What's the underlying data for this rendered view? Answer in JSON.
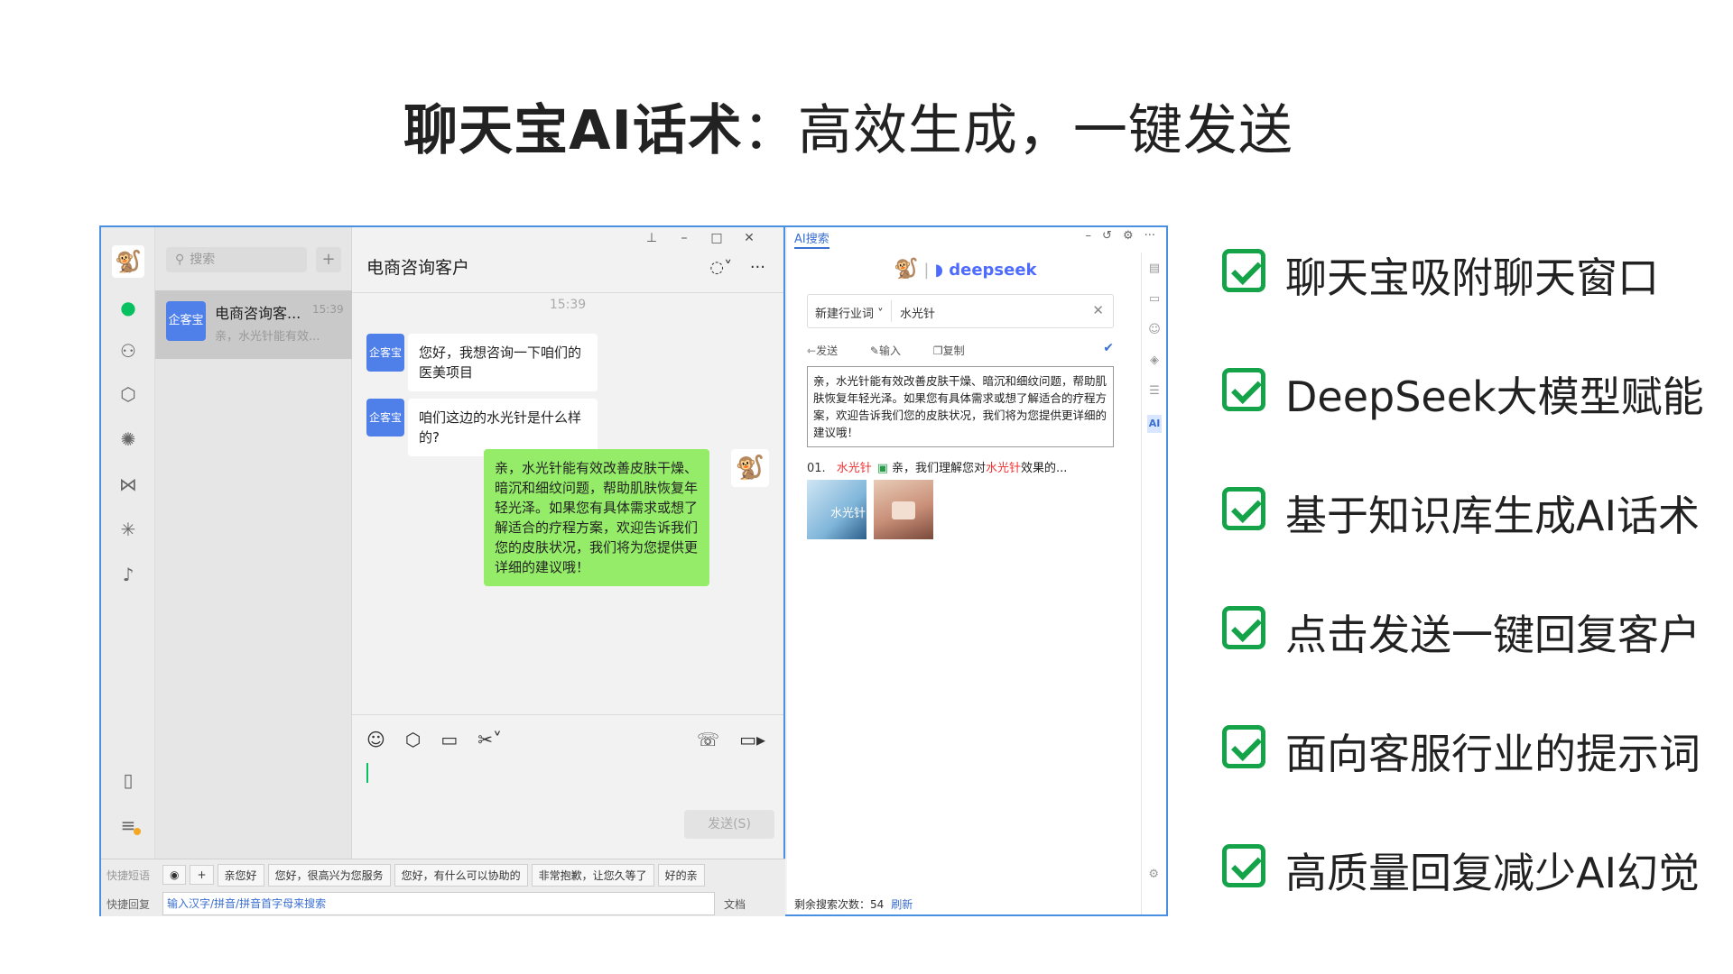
{
  "title": {
    "bold": "聊天宝AI话术",
    "rest": "：高效生成，一键发送"
  },
  "wechat": {
    "search_placeholder": "搜索",
    "conversation": {
      "avatar": "企客宝",
      "name": "电商咨询客...",
      "time": "15:39",
      "preview": "亲，水光针能有效..."
    },
    "chat_title": "电商咨询客户",
    "time_divider": "15:39",
    "messages": [
      {
        "avatar": "企客宝",
        "text": "您好，我想咨询一下咱们的医美项目"
      },
      {
        "avatar": "企客宝",
        "text": "咱们这边的水光针是什么样的?"
      },
      {
        "text": "亲，水光针能有效改善皮肤干燥、暗沉和细纹问题，帮助肌肤恢复年轻光泽。如果您有具体需求或想了解适合的疗程方案，欢迎告诉我们您的皮肤状况，我们将为您提供更详细的建议哦！"
      }
    ],
    "send_label": "发送(S)"
  },
  "quickbar": {
    "phrases_label": "快捷短语",
    "chips": [
      "亲您好",
      "您好，很高兴为您服务",
      "您好，有什么可以协助的",
      "非常抱歉，让您久等了",
      "好的亲"
    ],
    "reply_label": "快捷回复",
    "input_placeholder": "输入汉字/拼音/拼音首字母来搜索",
    "doc_label": "文档"
  },
  "ai_panel": {
    "tab": "AI搜索",
    "brand": "deepseek",
    "industry_select": "新建行业词",
    "keyword": "水光针",
    "actions": {
      "send": "发送",
      "input": "输入",
      "copy": "复制"
    },
    "answer": "亲，水光针能有效改善皮肤干燥、暗沉和细纹问题，帮助肌肤恢复年轻光泽。如果您有具体需求或想了解适合的疗程方案，欢迎告诉我们您的皮肤状况，我们将为您提供更详细的建议哦！",
    "result": {
      "num": "01.",
      "kw": "水光针",
      "text_pre": "亲，我们理解您对",
      "text_hl": "水光针",
      "text_post": "效果的..."
    },
    "thumb_text": "水光针",
    "side_ai": "AI",
    "footer_label": "剩余搜索次数：54",
    "footer_refresh": "刷新"
  },
  "features": [
    "聊天宝吸附聊天窗口",
    "DeepSeek大模型赋能",
    "基于知识库生成AI话术",
    "点击发送一键回复客户",
    "面向客服行业的提示词",
    "高质量回复减少AI幻觉"
  ],
  "colors": {
    "accent_green": "#15a34a",
    "wechat_green": "#95ec69",
    "frame_blue": "#4a90e2",
    "deepseek_blue": "#4d6bfe"
  }
}
